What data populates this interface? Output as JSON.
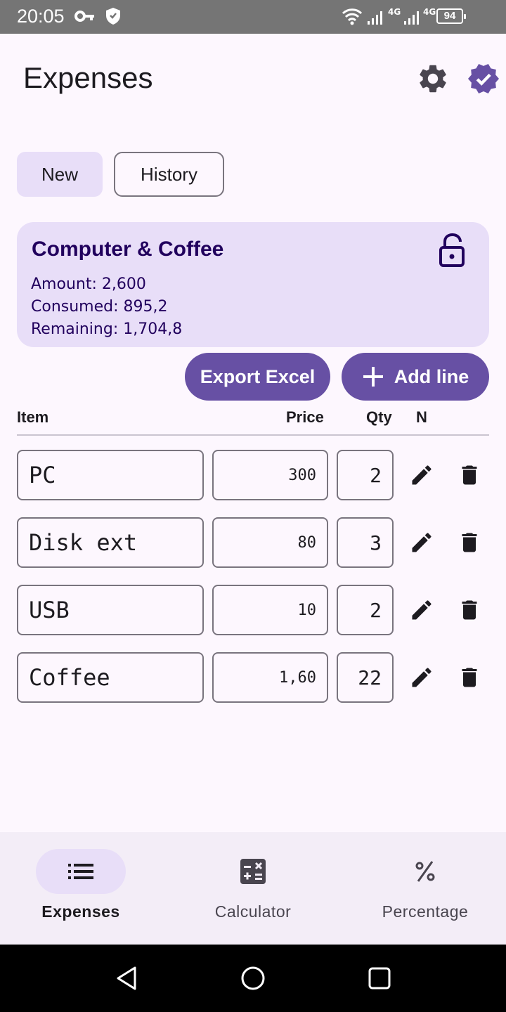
{
  "status_bar": {
    "time": "20:05",
    "network_label_1": "4G",
    "network_label_2": "4G",
    "battery": "94"
  },
  "app": {
    "title": "Expenses",
    "accent_color": "#6750a4"
  },
  "tabs": [
    {
      "label": "New",
      "selected": true
    },
    {
      "label": "History",
      "selected": false
    }
  ],
  "card": {
    "title": "Computer & Coffee",
    "amount": "Amount: 2,600",
    "consumed": "Consumed: 895,2",
    "remaining": "Remaining: 1,704,8",
    "lock_icon": "lock-open-icon"
  },
  "actions": {
    "export_label": "Export Excel",
    "add_label": "Add line"
  },
  "table": {
    "headers": {
      "item": "Item",
      "price": "Price",
      "qty": "Qty",
      "n": "N"
    },
    "rows": [
      {
        "item": "PC",
        "price": "300",
        "qty": "2"
      },
      {
        "item": "Disk ext",
        "price": "80",
        "qty": "3"
      },
      {
        "item": "USB",
        "price": "10",
        "qty": "2"
      },
      {
        "item": "Coffee",
        "price": "1,60",
        "qty": "22"
      }
    ]
  },
  "bottom_nav": [
    {
      "label": "Expenses",
      "icon": "list-icon",
      "active": true
    },
    {
      "label": "Calculator",
      "icon": "calculator-icon",
      "active": false
    },
    {
      "label": "Percentage",
      "icon": "percent-icon",
      "active": false
    }
  ]
}
